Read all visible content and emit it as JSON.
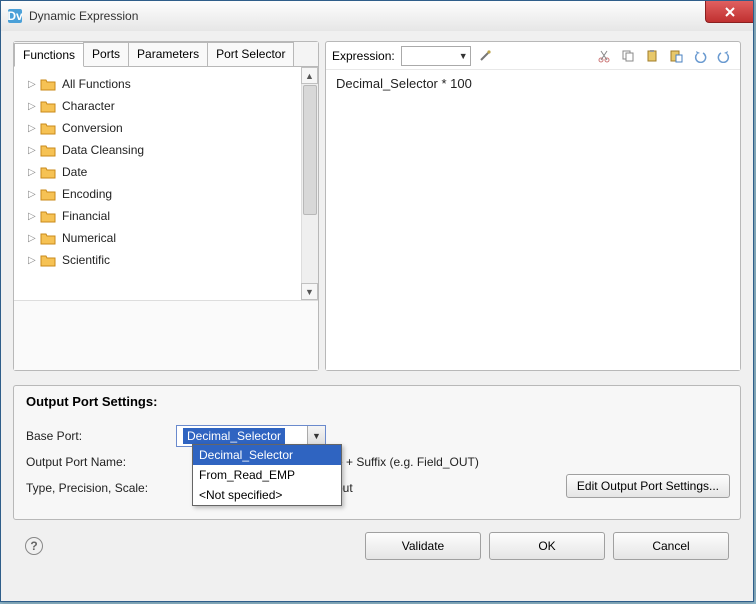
{
  "window": {
    "title": "Dynamic Expression"
  },
  "tabs": {
    "t0": "Functions",
    "t1": "Ports",
    "t2": "Parameters",
    "t3": "Port Selector"
  },
  "tree": {
    "items": [
      "All Functions",
      "Character",
      "Conversion",
      "Data Cleansing",
      "Date",
      "Encoding",
      "Financial",
      "Numerical",
      "Scientific"
    ]
  },
  "expr": {
    "label": "Expression:",
    "text": "Decimal_Selector * 100"
  },
  "toolbar_icons": {
    "wand": "wand-icon",
    "cut": "cut-icon",
    "copy": "copy-icon",
    "paste": "paste-icon",
    "paste2": "paste-special-icon",
    "undo": "undo-icon",
    "redo": "redo-icon"
  },
  "settings": {
    "heading": "Output Port Settings:",
    "base_port_label": "Base Port:",
    "base_port_value": "Decimal_Selector",
    "options": {
      "o0": "Decimal_Selector",
      "o1": "From_Read_EMP",
      "o2": "<Not specified>"
    },
    "output_port_name_label": "Output Port Name:",
    "output_port_name_suffix": "e + Suffix (e.g. Field_OUT)",
    "type_label": "Type, Precision, Scale:",
    "type_suffix": "put",
    "edit_button": "Edit Output Port Settings..."
  },
  "footer": {
    "validate": "Validate",
    "ok": "OK",
    "cancel": "Cancel"
  }
}
